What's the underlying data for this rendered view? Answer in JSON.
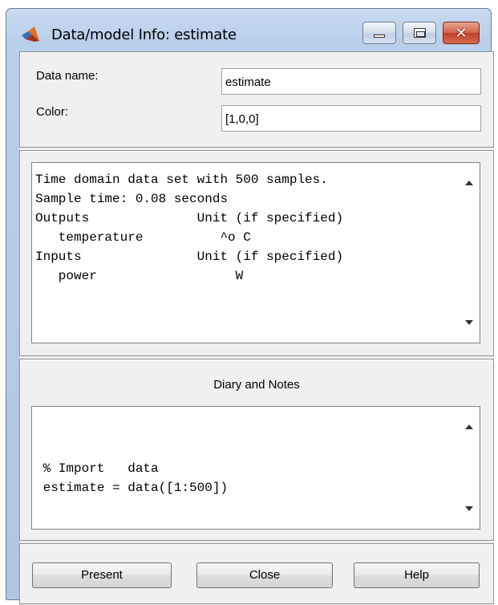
{
  "window": {
    "title": "Data/model Info: estimate"
  },
  "form": {
    "data_name_label": "Data name:",
    "data_name_value": "estimate",
    "color_label": "Color:",
    "color_value": "[1,0,0]"
  },
  "info": {
    "lines": [
      "Time domain data set with 500 samples.",
      "Sample time: 0.08 seconds",
      "Outputs              Unit (if specified)",
      "   temperature          ^o C",
      "Inputs               Unit (if specified)",
      "   power                  W"
    ]
  },
  "diary": {
    "title": "Diary and Notes",
    "lines": [
      "",
      "",
      " % Import   data",
      " estimate = data([1:500])"
    ]
  },
  "buttons": {
    "present": "Present",
    "close": "Close",
    "help": "Help"
  },
  "colors": {
    "matlab_logo_orange": "#e2701c",
    "close_button_red": "#c94a30"
  }
}
